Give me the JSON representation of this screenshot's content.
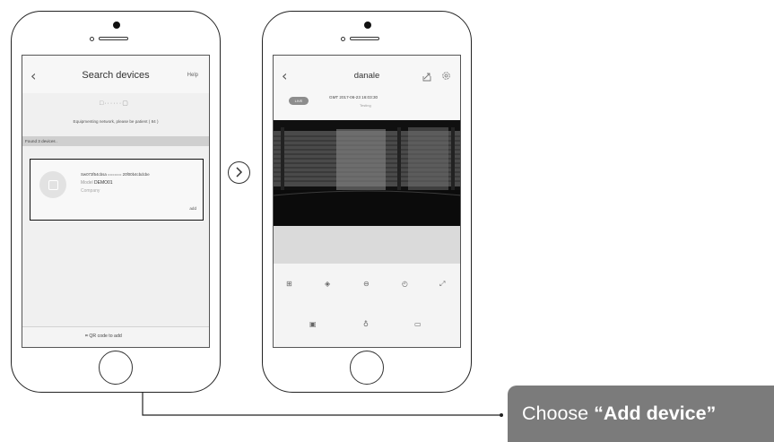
{
  "phone1": {
    "title": "Search devices",
    "help_label": "Help",
    "pairing_icon_text": "□······▢",
    "status_text": "Equipmenting network, please be patient ( 84 )",
    "found_text": "Found 3 devices .",
    "device": {
      "serial": "Sw073f54cbsa ====== 20f00b4cbdcbe",
      "model_label": "Model",
      "model_value": "DEMO01",
      "company_label": "Company",
      "add_label": "add"
    },
    "qr_text": "QR code to add"
  },
  "phone2": {
    "title": "danale",
    "live_badge": "LIVE",
    "timestamp": "GMT 2017-06-23 16:03:30",
    "rate_text": "Testing"
  },
  "callout": {
    "prefix": "Choose ",
    "emphasis": "“Add device”"
  },
  "icons": [
    "back-chevron-icon",
    "share-icon",
    "settings-icon",
    "next-arrow-icon",
    "qr-scan-icon",
    "grid-icon",
    "brightness-icon",
    "zoom-icon",
    "timer-icon",
    "fullscreen-icon",
    "snapshot-icon",
    "microphone-icon",
    "record-icon"
  ]
}
